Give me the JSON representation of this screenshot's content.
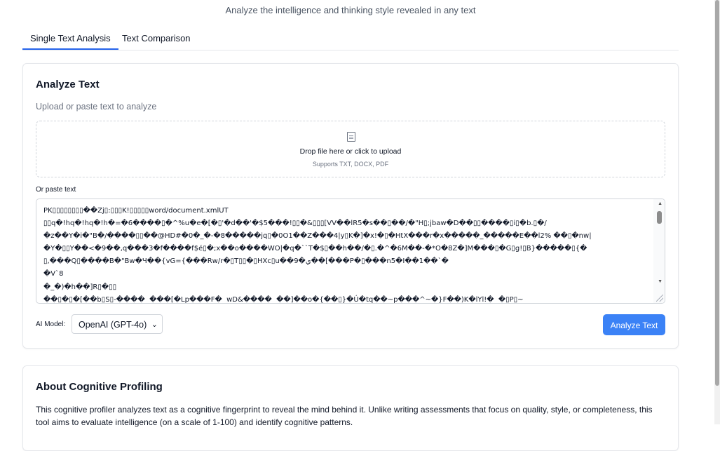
{
  "header": {
    "subtitle": "Analyze the intelligence and thinking style revealed in any text"
  },
  "tabs": [
    {
      "label": "Single Text Analysis",
      "active": true
    },
    {
      "label": "Text Comparison",
      "active": false
    }
  ],
  "analyze": {
    "title": "Analyze Text",
    "description": "Upload or paste text to analyze",
    "dropzone": {
      "icon": "file-icon",
      "title": "Drop file here or click to upload",
      "supports": "Supports TXT, DOCX, PDF"
    },
    "paste_label": "Or paste text",
    "textarea_value": "PK▯▯▯▯▯▯▯▯��Zj▯:▯▯▯K!▯▯▯▯▯word/document.xmlUT\n▯▯q�!hq�!hq�!h�=�6����▯�^%u�e�[�▯'�d��'�$5���!▯▯�&▯▯▯[VV��lR5�s��▯��/�\"H▯;jbaw�D��▯▯����▯i▯�b.▯�/\n�z��Y�i�\"B�/����▯▯��@HD#�0�_�-�8�����jq▯�0O1��Z���4|y▯K�]�x!�▯�HtX���r�x�����_�����E��l2% ��▯�nw|\n�Y�▯▯Y��<�9��,q���3�f����f$é▯�;x��o����WO|�q�``T�$▯��h��/�▯.�^�6M��-�*O�8Z�]M���▯�G▯g!▯B}�����▯{�\n▯,���Q▯����B�\"Bw�Ч��{vG={���Rw/r�▯T▯▯�▯HXc▯u��9�ي��[���P�▯���n5�I��1��`�\n�V`8\n�_�)�h��]R▯�▯▯\n��▯�▯�[��b▯S▯-����  ���[�Lp���F�  wD&����  ��]��o�{��▯}�Ú�tq��~p���^~�}F��)K�lYl!�  �▯P▯~",
    "model_label": "AI Model:",
    "model_value": "OpenAI (GPT-4o)",
    "analyze_button": "Analyze Text"
  },
  "about": {
    "title": "About Cognitive Profiling",
    "text": "This cognitive profiler analyzes text as a cognitive fingerprint to reveal the mind behind it. Unlike writing assessments that focus on quality, style, or completeness, this tool aims to evaluate intelligence (on a scale of 1-100) and identify cognitive patterns."
  }
}
